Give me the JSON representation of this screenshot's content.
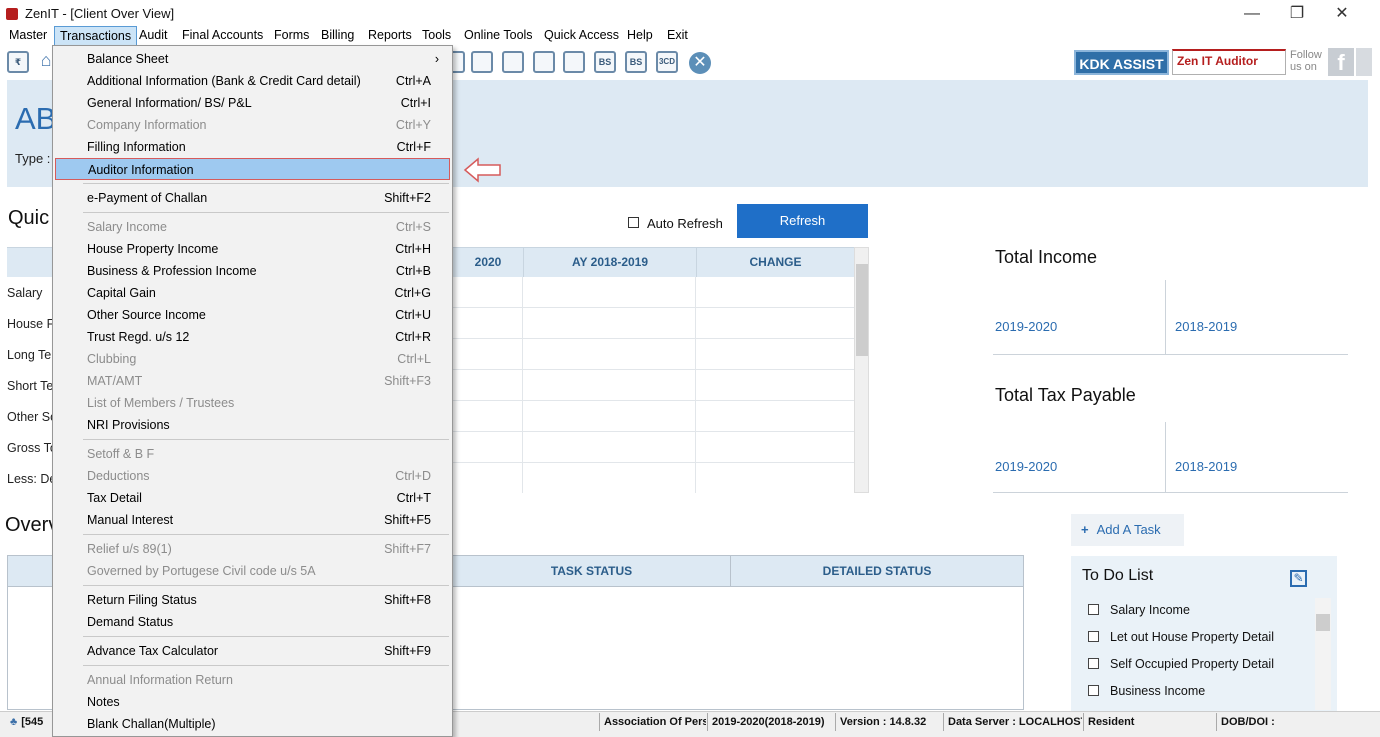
{
  "window": {
    "title": "ZenIT - [Client Over View]",
    "minimize": "—",
    "maximize": "❐",
    "close": "✕"
  },
  "menu": [
    "Master",
    "Transactions",
    "Audit",
    "Final Accounts",
    "Forms",
    "Billing",
    "Reports",
    "Tools",
    "Online Tools",
    "Quick Access",
    "Help",
    "Exit"
  ],
  "toolbar": {
    "icons": [
      "rupee-book-icon",
      "home-icon",
      "calc-icon",
      "user-doc-icon",
      "calendar-icon",
      "add-doc-icon",
      "refresh-doc-icon",
      "bs-icon",
      "bs-sch-icon",
      "3cd-icon",
      "close-circle-icon"
    ],
    "bs": "BS",
    "bs_sch": "BS",
    "cd3": "3CD",
    "x": "✕"
  },
  "brand": {
    "kdk": "KDK ASSIST",
    "auditor": "Zen IT Auditor",
    "follow": "Follow us on",
    "fb": "f"
  },
  "client": {
    "name": "AB",
    "type_label": "Type :"
  },
  "sections": {
    "quick": "Quic",
    "overview": "Overv"
  },
  "left_rows": [
    "Salary",
    "House F",
    "Long Te",
    "Short Te",
    "Other So",
    "Gross To",
    "Less: De"
  ],
  "grid": {
    "headers": [
      "2020",
      "AY 2018-2019",
      "CHANGE"
    ]
  },
  "auto_refresh": "Auto Refresh",
  "refresh": "Refresh",
  "total_income": {
    "title": "Total Income",
    "y1": "2019-2020",
    "y2": "2018-2019"
  },
  "total_tax": {
    "title": "Total Tax Payable",
    "y1": "2019-2020",
    "y2": "2018-2019"
  },
  "add_task": "Add A Task",
  "add_plus": "+",
  "todo": {
    "title": "To Do List",
    "items": [
      "Salary Income",
      "Let out House Property Detail",
      "Self Occupied Property Detail",
      "Business Income"
    ]
  },
  "task_table": {
    "headers": [
      "TASK STATUS",
      "DETAILED STATUS"
    ]
  },
  "status": {
    "id": "[545",
    "assoc": "Association Of Pers",
    "ay": "2019-2020(2018-2019)",
    "version": "Version : 14.8.32",
    "server": "Data Server : LOCALHOST",
    "res": "Resident",
    "dob": "DOB/DOI :"
  },
  "dropdown": [
    {
      "label": "Balance Sheet",
      "shortcut": "",
      "submenu": true
    },
    {
      "label": "Additional Information (Bank & Credit Card detail)",
      "shortcut": "Ctrl+A"
    },
    {
      "label": "General Information/ BS/ P&L",
      "shortcut": "Ctrl+I"
    },
    {
      "label": "Company Information",
      "shortcut": "Ctrl+Y",
      "disabled": true
    },
    {
      "label": "Filling Information",
      "shortcut": "Ctrl+F"
    },
    {
      "label": "Auditor Information",
      "shortcut": "",
      "highlight": true
    },
    {
      "sep": true
    },
    {
      "label": "e-Payment of Challan",
      "shortcut": "Shift+F2"
    },
    {
      "sep": true
    },
    {
      "label": "Salary Income",
      "shortcut": "Ctrl+S",
      "disabled": true
    },
    {
      "label": "House Property Income",
      "shortcut": "Ctrl+H"
    },
    {
      "label": "Business & Profession Income",
      "shortcut": "Ctrl+B"
    },
    {
      "label": "Capital Gain",
      "shortcut": "Ctrl+G"
    },
    {
      "label": "Other Source Income",
      "shortcut": "Ctrl+U"
    },
    {
      "label": "Trust Regd. u/s 12",
      "shortcut": "Ctrl+R"
    },
    {
      "label": "Clubbing",
      "shortcut": "Ctrl+L",
      "disabled": true
    },
    {
      "label": "MAT/AMT",
      "shortcut": "Shift+F3",
      "disabled": true
    },
    {
      "label": "List of Members / Trustees",
      "shortcut": "",
      "disabled": true
    },
    {
      "label": "NRI Provisions",
      "shortcut": ""
    },
    {
      "sep": true
    },
    {
      "label": "Setoff & B F",
      "shortcut": "",
      "disabled": true
    },
    {
      "label": "Deductions",
      "shortcut": "Ctrl+D",
      "disabled": true
    },
    {
      "label": "Tax Detail",
      "shortcut": "Ctrl+T"
    },
    {
      "label": "Manual Interest",
      "shortcut": "Shift+F5"
    },
    {
      "sep": true
    },
    {
      "label": "Relief u/s 89(1)",
      "shortcut": "Shift+F7",
      "disabled": true
    },
    {
      "label": "Governed by Portugese Civil code u/s 5A",
      "shortcut": "",
      "disabled": true
    },
    {
      "sep": true
    },
    {
      "label": "Return Filing Status",
      "shortcut": "Shift+F8"
    },
    {
      "label": "Demand Status",
      "shortcut": ""
    },
    {
      "sep": true
    },
    {
      "label": "Advance Tax Calculator",
      "shortcut": "Shift+F9"
    },
    {
      "sep": true
    },
    {
      "label": "Annual Information Return",
      "shortcut": "",
      "disabled": true
    },
    {
      "label": "Notes",
      "shortcut": ""
    },
    {
      "label": "Blank Challan(Multiple)",
      "shortcut": ""
    }
  ],
  "colors": {
    "accent": "#1f6fc8",
    "banner": "#dde9f3",
    "brand_red": "#b51e1e",
    "highlight": "#9ec9f0"
  }
}
